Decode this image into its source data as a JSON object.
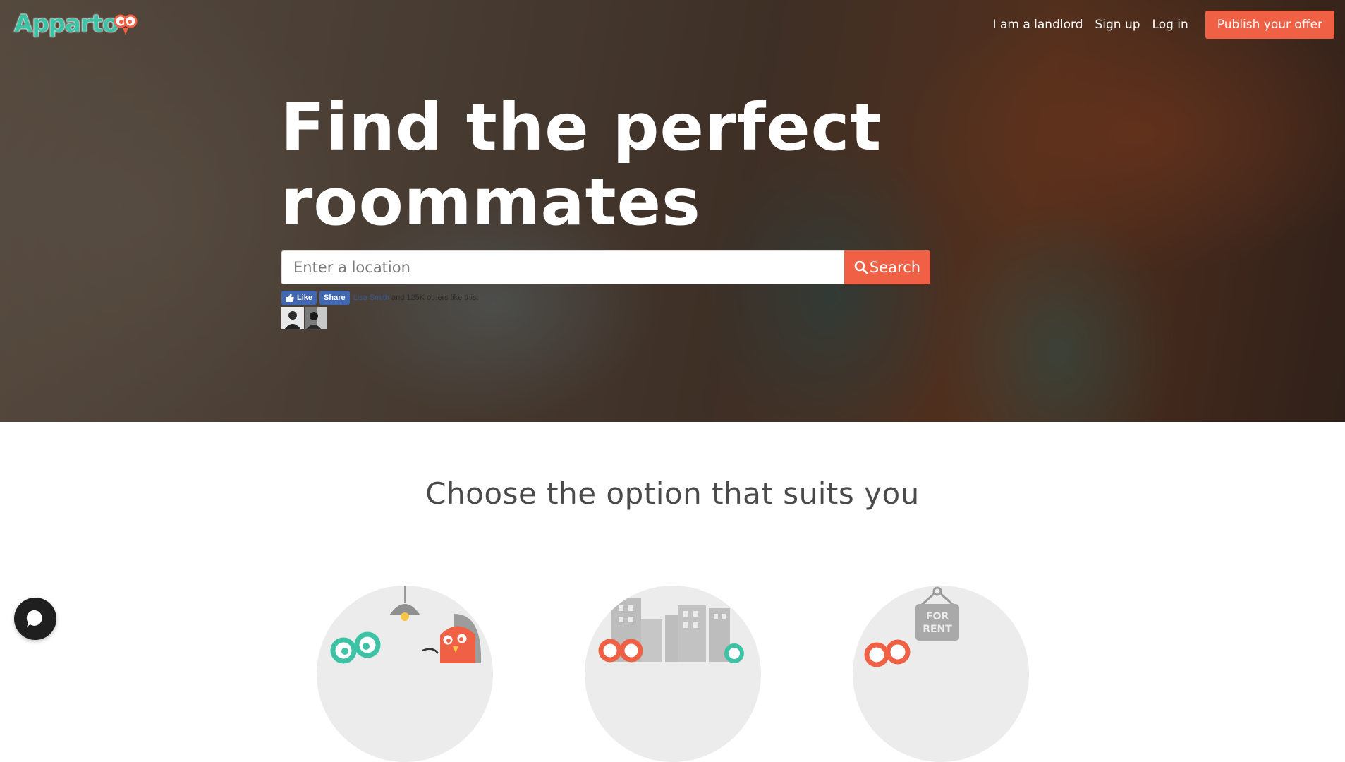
{
  "brand": {
    "name": "Apparto",
    "accent": "#ef6044",
    "logo_color": "#3ec2a6"
  },
  "nav": {
    "landlord": "I am a landlord",
    "signup": "Sign up",
    "login": "Log in",
    "publish": "Publish your offer"
  },
  "hero": {
    "headline_line1": "Find the perfect",
    "headline_line2": "roommates",
    "search_placeholder": "Enter a location",
    "search_button": "Search"
  },
  "facebook": {
    "like": "Like",
    "share": "Share",
    "friend": "Lisa Smith",
    "others": "and 125K others like this."
  },
  "options_section": {
    "title": "Choose the option that suits you",
    "sign_text": "FOR RENT"
  },
  "icons": [
    "search-icon",
    "thumbs-up-icon",
    "chat-icon"
  ]
}
